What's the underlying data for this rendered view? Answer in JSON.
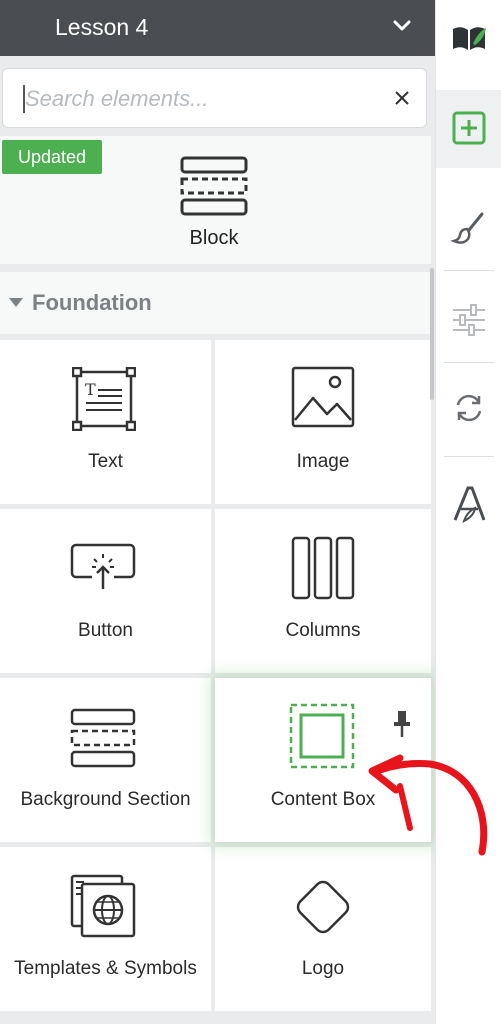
{
  "header": {
    "title": "Lesson 4"
  },
  "search": {
    "placeholder": "Search elements..."
  },
  "block": {
    "badge": "Updated",
    "label": "Block"
  },
  "section": {
    "title": "Foundation"
  },
  "elements": [
    {
      "label": "Text",
      "icon": "text-icon"
    },
    {
      "label": "Image",
      "icon": "image-icon"
    },
    {
      "label": "Button",
      "icon": "button-icon"
    },
    {
      "label": "Columns",
      "icon": "columns-icon"
    },
    {
      "label": "Background Section",
      "icon": "background-section-icon"
    },
    {
      "label": "Content Box",
      "icon": "content-box-icon",
      "pinned": true
    },
    {
      "label": "Templates & Symbols",
      "icon": "templates-symbols-icon"
    },
    {
      "label": "Logo",
      "icon": "logo-icon"
    }
  ],
  "rail": [
    {
      "icon": "book-logo-icon"
    },
    {
      "icon": "add-element-icon",
      "active": true
    },
    {
      "icon": "paintbrush-icon"
    },
    {
      "icon": "sliders-icon"
    },
    {
      "icon": "sync-icon"
    },
    {
      "icon": "typography-icon"
    }
  ],
  "colors": {
    "accent": "#4caf50",
    "header": "#4a4d51",
    "annotation_arrow": "#e8141c"
  }
}
